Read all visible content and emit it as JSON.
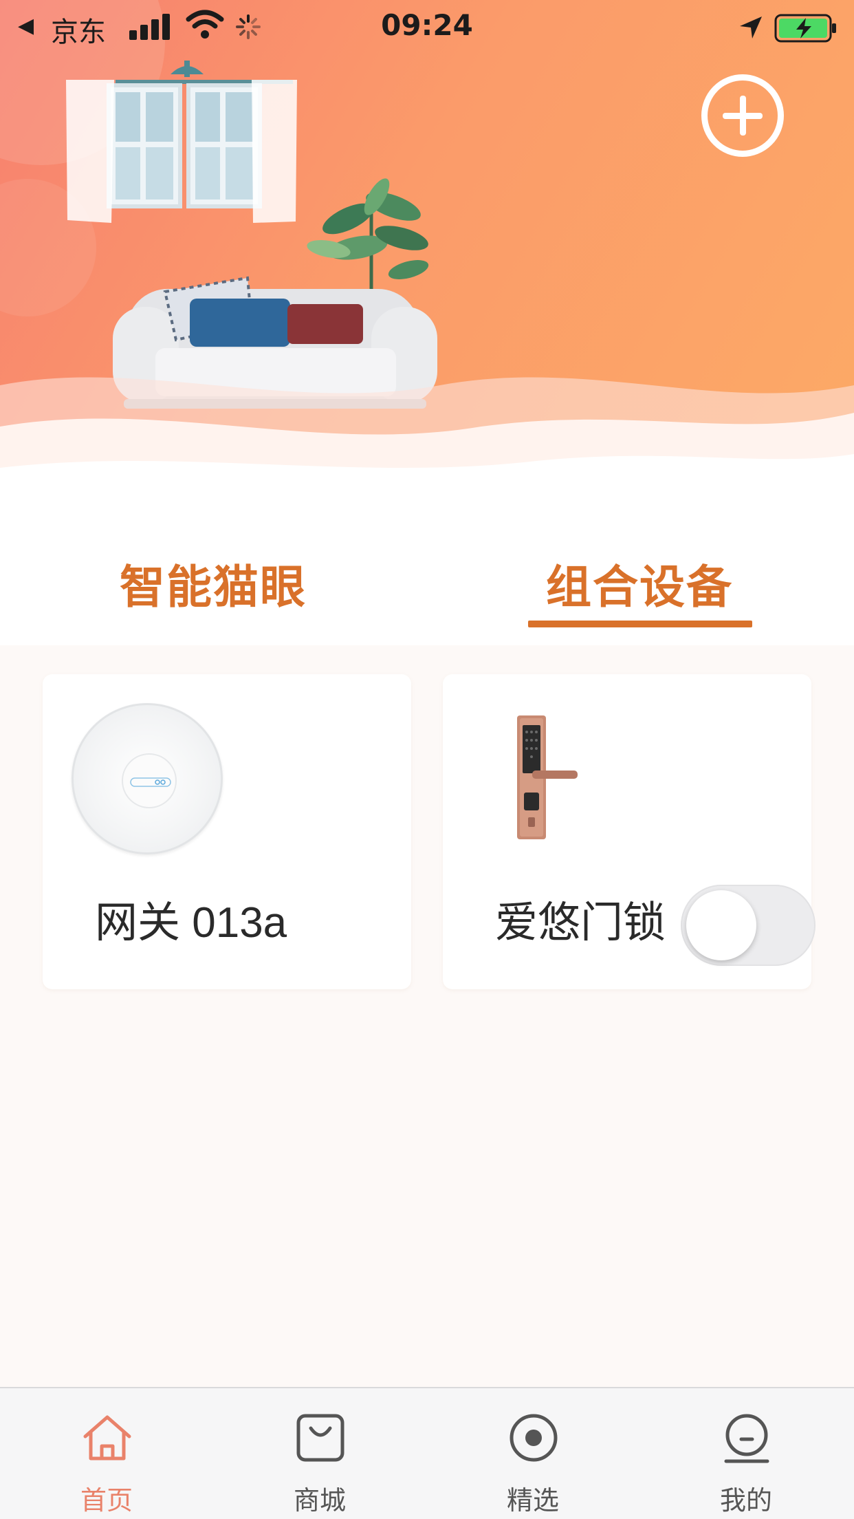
{
  "status_bar": {
    "back_app": "京东",
    "time": "09:24"
  },
  "tabs": [
    {
      "label": "智能猫眼",
      "active": false
    },
    {
      "label": "组合设备",
      "active": true
    }
  ],
  "devices": [
    {
      "name": "网关 013a",
      "icon": "gateway-device-icon"
    },
    {
      "name": "爱悠门锁",
      "icon": "door-lock-icon",
      "toggle_on": false
    }
  ],
  "bottom_nav": [
    {
      "label": "首页",
      "icon": "home-icon",
      "active": true
    },
    {
      "label": "商城",
      "icon": "shopping-bag-icon",
      "active": false
    },
    {
      "label": "精选",
      "icon": "target-icon",
      "active": false
    },
    {
      "label": "我的",
      "icon": "profile-icon",
      "active": false
    }
  ],
  "colors": {
    "accent": "#d9712a",
    "nav_active": "#e9826a",
    "hero_gradient_start": "#f7806f",
    "hero_gradient_end": "#fcaa66"
  }
}
